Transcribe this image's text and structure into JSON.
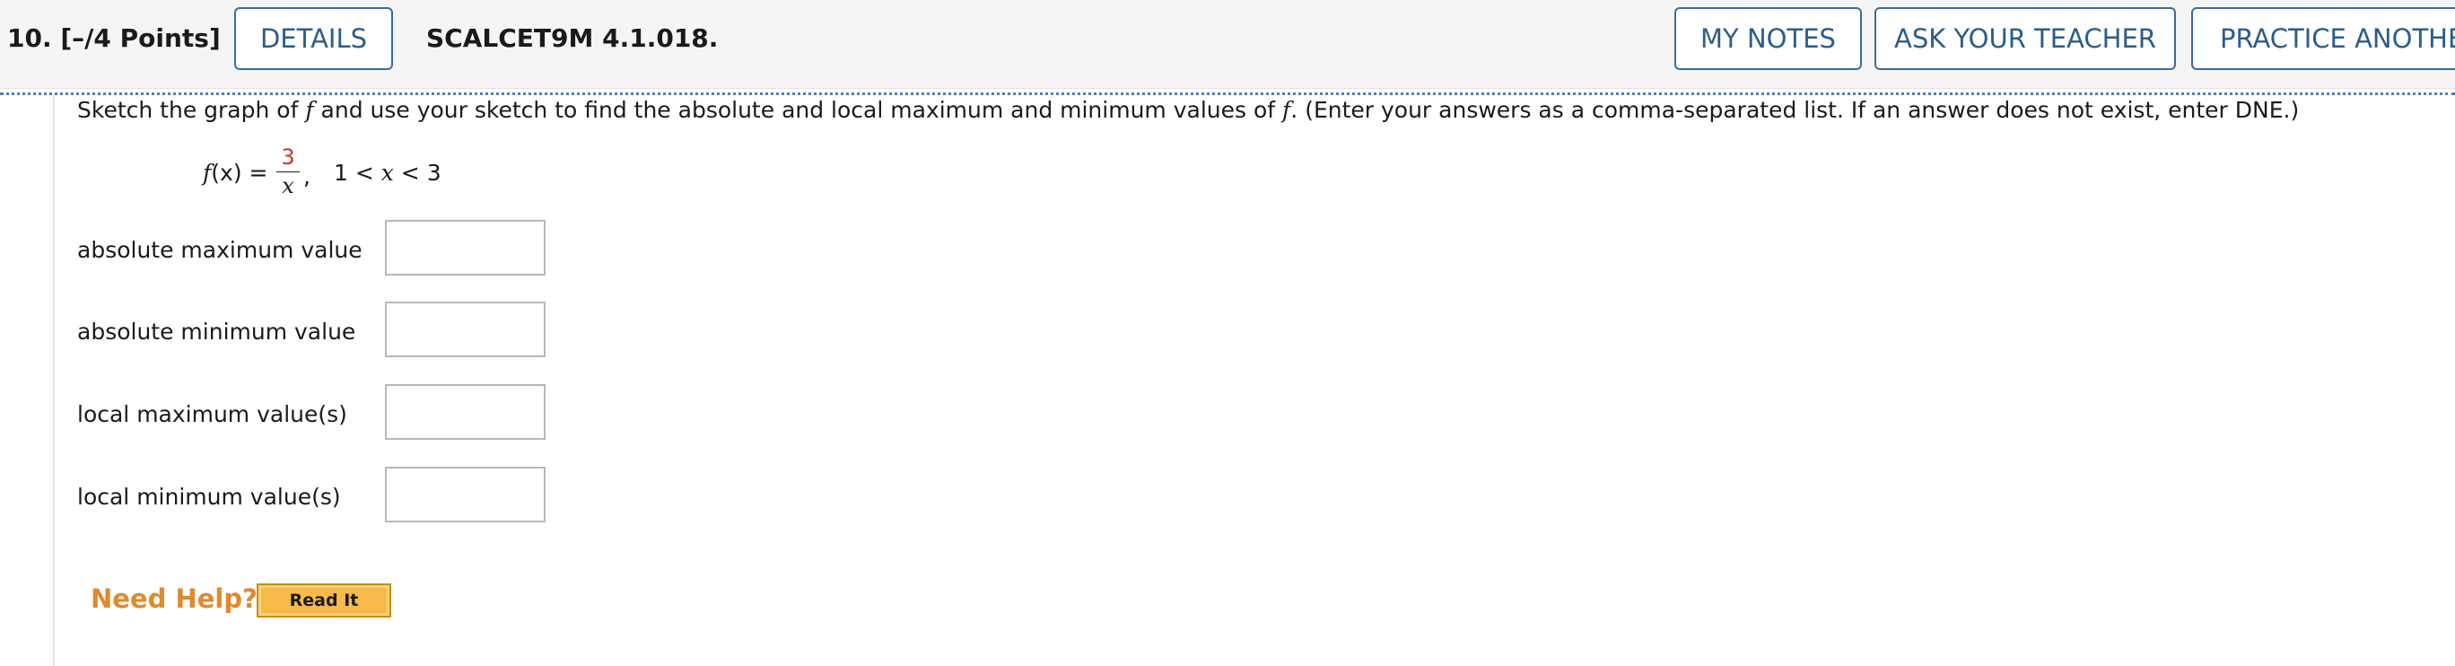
{
  "header": {
    "question_number": "10.",
    "points": "[–/4 Points]",
    "details_label": "DETAILS",
    "problem_code": "SCALCET9M 4.1.018.",
    "my_notes_label": "MY NOTES",
    "ask_teacher_label": "ASK YOUR TEACHER",
    "practice_label": "PRACTICE ANOTHER"
  },
  "question": {
    "instructions_part1": "Sketch the graph of ",
    "f1": "f",
    "instructions_part2": " and use your sketch to find the absolute and local maximum and minimum values of ",
    "f2": "f",
    "instructions_part3": ". (Enter your answers as a comma-separated list. If an answer does not exist, enter DNE.)",
    "formula": {
      "lhs_f": "f",
      "lhs_rest": "(x) =",
      "numerator": "3",
      "denominator": "x",
      "comma": ",",
      "domain_left": "1 < ",
      "domain_var": "x",
      "domain_right": " < 3"
    }
  },
  "answers": [
    {
      "label": "absolute maximum value",
      "value": ""
    },
    {
      "label": "absolute minimum value",
      "value": ""
    },
    {
      "label": "local maximum value(s)",
      "value": ""
    },
    {
      "label": "local minimum value(s)",
      "value": ""
    }
  ],
  "help": {
    "need_help_label": "Need Help?",
    "read_it_label": "Read It"
  },
  "colors": {
    "button_border": "#3b6c9a",
    "button_text": "#2c5d8a",
    "numerator_red": "#c0392b",
    "need_help_orange": "#e08a2d",
    "read_it_bg": "#f6b94a",
    "dotted_rule": "#4a7fc0"
  }
}
